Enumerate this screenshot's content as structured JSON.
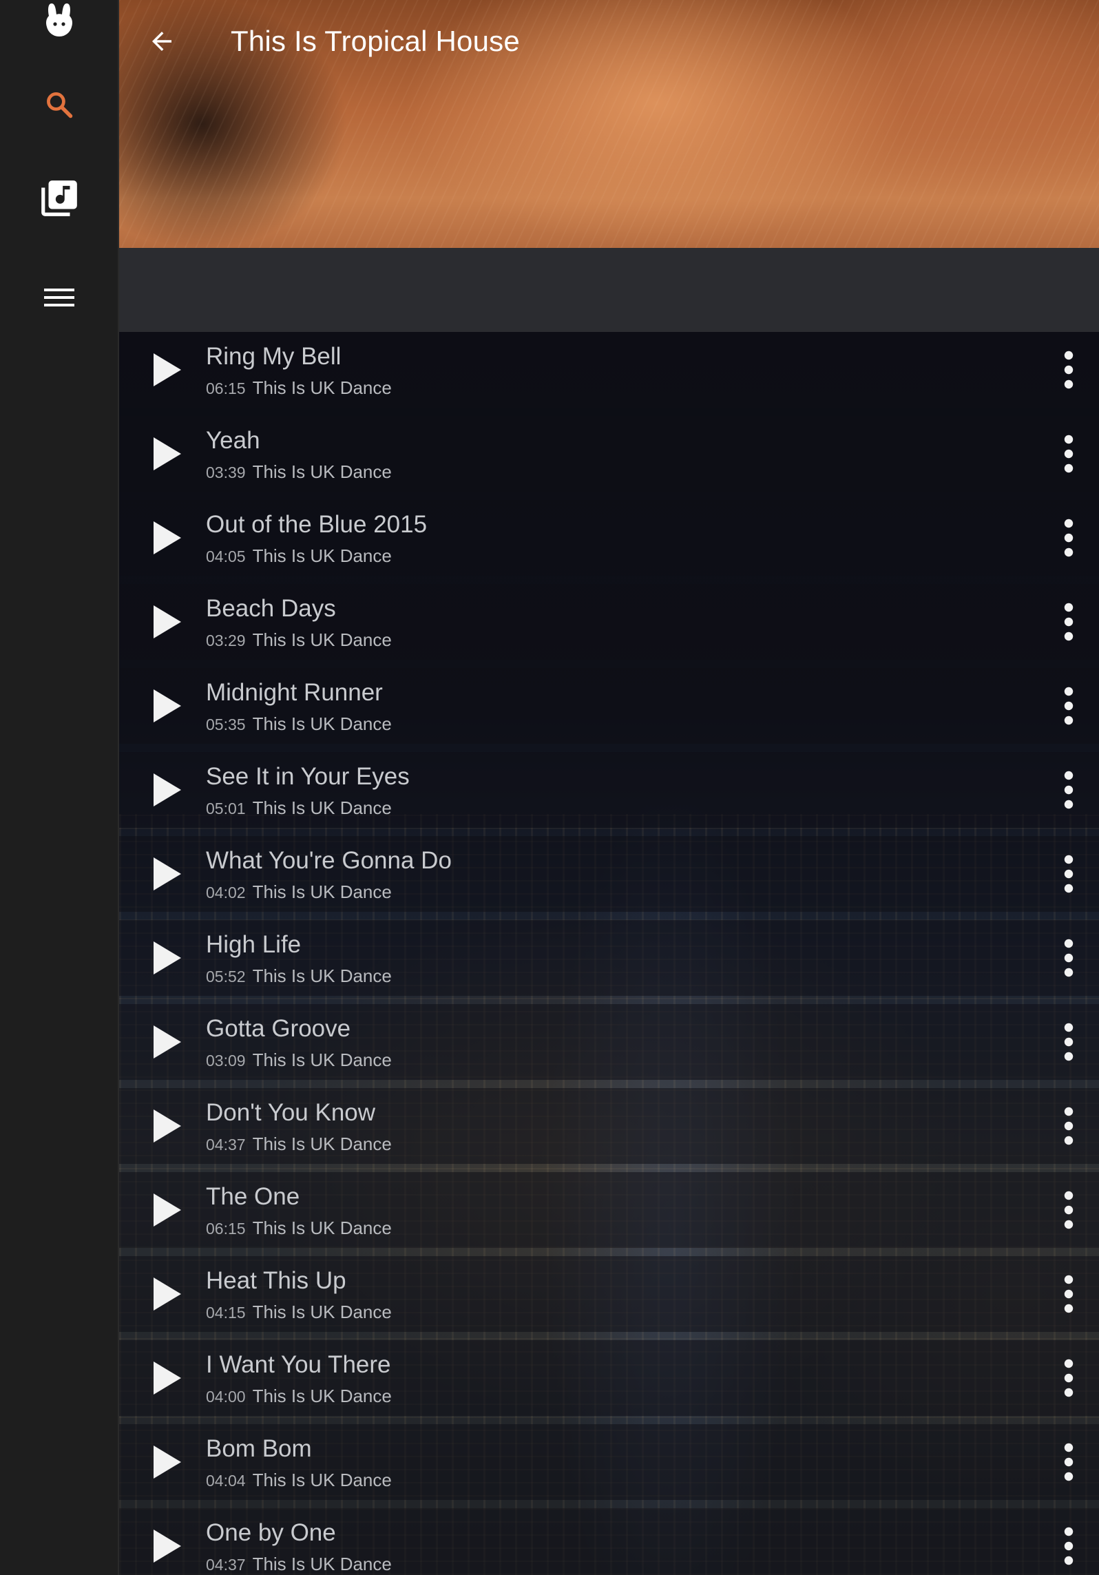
{
  "app": {
    "accent_color": "#d4843a",
    "rail_icons": [
      "rabbit-logo-icon",
      "search-icon",
      "music-library-icon",
      "menu-icon"
    ]
  },
  "header": {
    "title": "This Is Tropical House",
    "back_icon": "arrow-left-icon",
    "fab_icon": "plus-icon"
  },
  "tracks": [
    {
      "title": "Ring My Bell",
      "duration": "06:15",
      "album": "This Is UK Dance"
    },
    {
      "title": "Yeah",
      "duration": "03:39",
      "album": "This Is UK Dance"
    },
    {
      "title": "Out of the Blue 2015",
      "duration": "04:05",
      "album": "This Is UK Dance"
    },
    {
      "title": "Beach Days",
      "duration": "03:29",
      "album": "This Is UK Dance"
    },
    {
      "title": "Midnight Runner",
      "duration": "05:35",
      "album": "This Is UK Dance"
    },
    {
      "title": "See It in Your Eyes",
      "duration": "05:01",
      "album": "This Is UK Dance"
    },
    {
      "title": "What You're Gonna Do",
      "duration": "04:02",
      "album": "This Is UK Dance"
    },
    {
      "title": "High Life",
      "duration": "05:52",
      "album": "This Is UK Dance"
    },
    {
      "title": "Gotta Groove",
      "duration": "03:09",
      "album": "This Is UK Dance"
    },
    {
      "title": "Don't You Know",
      "duration": "04:37",
      "album": "This Is UK Dance"
    },
    {
      "title": "The One",
      "duration": "06:15",
      "album": "This Is UK Dance"
    },
    {
      "title": "Heat This Up",
      "duration": "04:15",
      "album": "This Is UK Dance"
    },
    {
      "title": "I Want You There",
      "duration": "04:00",
      "album": "This Is UK Dance"
    },
    {
      "title": "Bom Bom",
      "duration": "04:04",
      "album": "This Is UK Dance"
    },
    {
      "title": "One by One",
      "duration": "04:37",
      "album": "This Is UK Dance"
    }
  ]
}
